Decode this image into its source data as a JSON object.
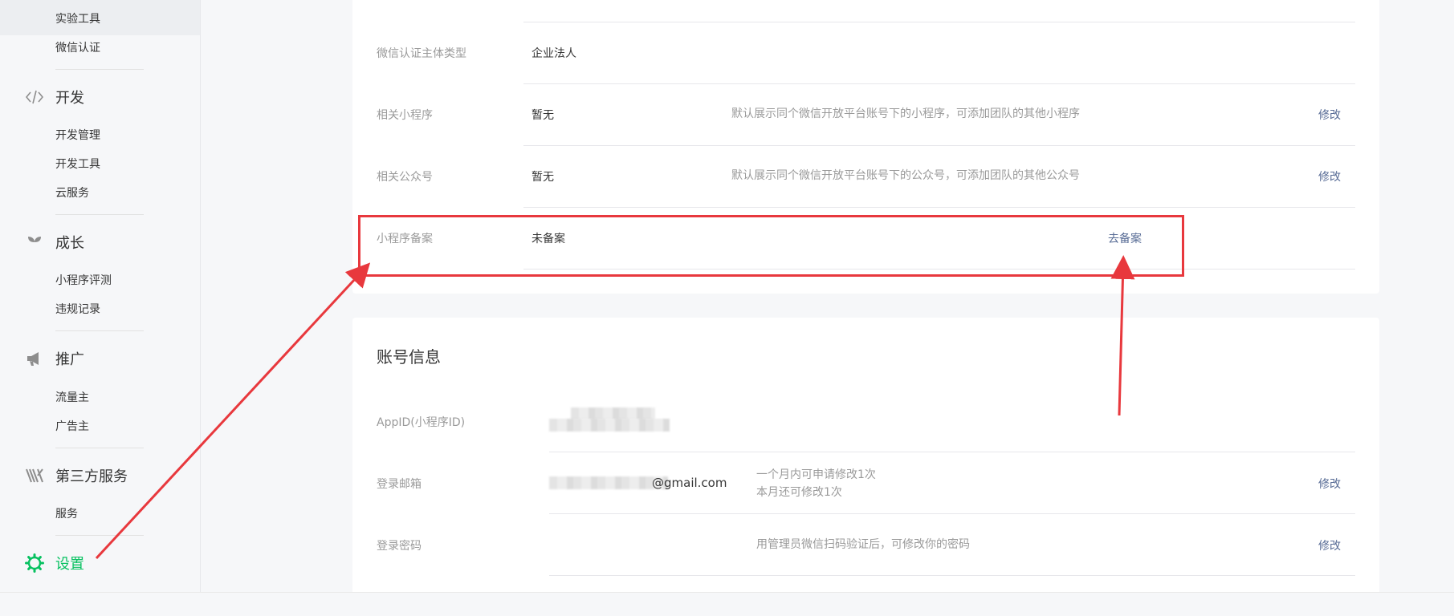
{
  "sidebar": {
    "top_items": [
      "实验工具",
      "微信认证"
    ],
    "categories": [
      {
        "icon": "code-icon",
        "label": "开发",
        "items": [
          "开发管理",
          "开发工具",
          "云服务"
        ]
      },
      {
        "icon": "sprout-icon",
        "label": "成长",
        "items": [
          "小程序评测",
          "违规记录"
        ]
      },
      {
        "icon": "megaphone-icon",
        "label": "推广",
        "items": [
          "流量主",
          "广告主"
        ]
      },
      {
        "icon": "third-party-icon",
        "label": "第三方服务",
        "items": [
          "服务"
        ]
      }
    ],
    "settings": {
      "icon": "gear-icon",
      "label": "设置"
    }
  },
  "basic_info": {
    "rows": [
      {
        "label": "微信认证主体类型",
        "value": "企业法人",
        "desc": "",
        "action": ""
      },
      {
        "label": "相关小程序",
        "value": "暂无",
        "desc": "默认展示同个微信开放平台账号下的小程序，可添加团队的其他小程序",
        "action": "修改"
      },
      {
        "label": "相关公众号",
        "value": "暂无",
        "desc": "默认展示同个微信开放平台账号下的公众号，可添加团队的其他公众号",
        "action": "修改"
      },
      {
        "label": "小程序备案",
        "value": "未备案",
        "desc": "",
        "action": "去备案"
      }
    ]
  },
  "account_info": {
    "title": "账号信息",
    "appid_label": "AppID(小程序ID)",
    "email": {
      "label": "登录邮箱",
      "value": "@gmail.com",
      "desc_line1": "一个月内可申请修改1次",
      "desc_line2": "本月还可修改1次",
      "action": "修改"
    },
    "password": {
      "label": "登录密码",
      "desc": "用管理员微信扫码验证后，可修改你的密码",
      "action": "修改"
    }
  },
  "colors": {
    "accent_green": "#07c160",
    "link_blue": "#576b95",
    "annotation_red": "#e8383d"
  }
}
